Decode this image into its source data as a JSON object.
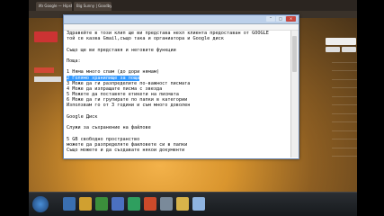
{
  "browser": {
    "tabs": [
      "Из Google — Hipstenter...",
      "Big Sunny | Goodbye..."
    ]
  },
  "gmail": {
    "sidebar_items": [
      "",
      "",
      "",
      "",
      "",
      "",
      "",
      "",
      ""
    ],
    "mail_dates": [
      "",
      "",
      "",
      "",
      "",
      "",
      "",
      "",
      "",
      "",
      "",
      ""
    ]
  },
  "notepad": {
    "title": "",
    "menu": [
      "",
      "",
      "",
      "",
      ""
    ],
    "lines": [
      "Здравейте в този клип ще ви представа нехл клиента предоставан от GOOGLE",
      "той се казва Gmail,също така и органиатора и Google диск",
      "",
      "Също ще ви представя и неговите функции",
      "",
      "Поща:",
      "",
      "1 Няма много спам (до дори нямам)",
      "2 Голямо хранилище за поща",
      "3 Може да ги разпределите по-важност писмата",
      "4 Може да изпращате писма с звезда",
      "5 Можете да поставяте етикети на писмата",
      "6 Може да ги групирате по папки в категории",
      "Използвам го от 3 години и съм много доволен",
      "",
      "Google Диск",
      "",
      "Служи за съхранение на файлове",
      "",
      "5 GB свободно пространство",
      "можете да разпределяте фаиловете си в папки",
      "Също можете и да създавате някои документи"
    ],
    "selected_line_index": 8
  },
  "taskbar": {
    "clock_time": "",
    "clock_date": ""
  }
}
